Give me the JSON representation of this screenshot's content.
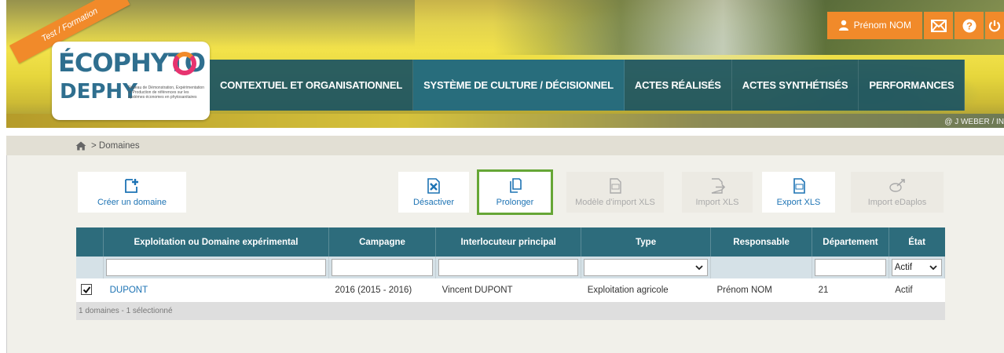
{
  "header": {
    "ribbon": "Test / Formation",
    "logo": {
      "line1": "ÉCOPHYTO",
      "line2": "DEPHY",
      "tagline": "Réseau de Démonstration, Expérimentation et Production de références sur les systèmes économes en phytosanitaires"
    },
    "nav": [
      {
        "label": "CONTEXTUEL ET ORGANISATIONNEL"
      },
      {
        "label": "SYSTÈME DE CULTURE / DÉCISIONNEL"
      },
      {
        "label": "ACTES RÉALISÉS"
      },
      {
        "label": "ACTES SYNTHÉTISÉS"
      },
      {
        "label": "PERFORMANCES"
      }
    ],
    "user": "Prénom NOM",
    "photo_credit": "@ J WEBER / IN"
  },
  "breadcrumb": {
    "current": "> Domaines"
  },
  "toolbar": {
    "create": "Créer un domaine",
    "deactivate": "Désactiver",
    "extend": "Prolonger",
    "template_xls": "Modèle d'import XLS",
    "import_xls": "Import XLS",
    "export_xls": "Export XLS",
    "import_edaplos": "Import eDaplos"
  },
  "table": {
    "columns": [
      "Exploitation ou Domaine expérimental",
      "Campagne",
      "Interlocuteur principal",
      "Type",
      "Responsable",
      "Département",
      "État"
    ],
    "filters": {
      "type": "",
      "state": "Actif"
    },
    "rows": [
      {
        "checked": true,
        "name": "DUPONT",
        "campaign": "2016 (2015 - 2016)",
        "contact": "Vincent DUPONT",
        "type": "Exploitation agricole",
        "manager": "Prénom NOM",
        "department": "21",
        "state": "Actif"
      }
    ],
    "footer": "1 domaines - 1 sélectionné"
  },
  "colors": {
    "orange": "#f18a2a",
    "nav_bg": "#1c5462",
    "table_header": "#2d6c7c",
    "link": "#1d73b4",
    "highlight": "#66a636"
  }
}
